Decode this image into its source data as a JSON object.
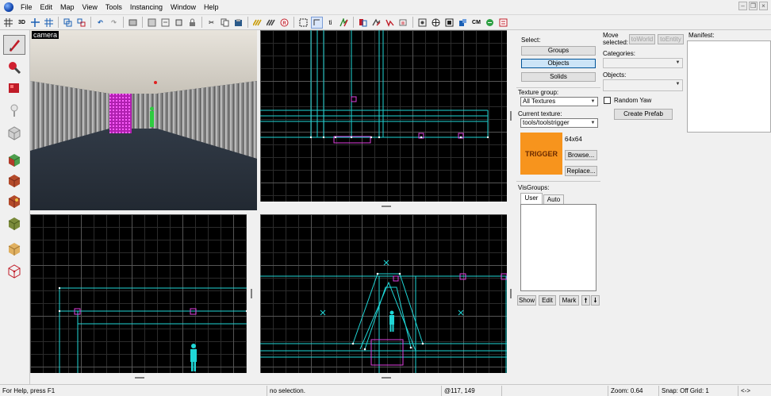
{
  "menu": {
    "items": [
      {
        "label": "File"
      },
      {
        "label": "Edit"
      },
      {
        "label": "Map"
      },
      {
        "label": "View"
      },
      {
        "label": "Tools"
      },
      {
        "label": "Instancing"
      },
      {
        "label": "Window"
      },
      {
        "label": "Help"
      }
    ]
  },
  "toolbar": {
    "cordon_label": "CM"
  },
  "viewports": {
    "camera_label": "camera"
  },
  "select_panel": {
    "label": "Select:",
    "groups_button": "Groups",
    "objects_button": "Objects",
    "solids_button": "Solids"
  },
  "texture_panel": {
    "group_label": "Texture group:",
    "group_value": "All Textures",
    "current_label": "Current texture:",
    "current_value": "tools/toolstrigger",
    "preview_text": "TRIGGER",
    "preview_color": "#f7941d",
    "size_text": "64x64",
    "browse_button": "Browse...",
    "replace_button": "Replace..."
  },
  "visgroups": {
    "label": "VisGroups:",
    "tabs": [
      "User",
      "Auto"
    ],
    "show_button": "Show",
    "edit_button": "Edit",
    "mark_button": "Mark",
    "up_icon": "up-arrow-icon",
    "down_icon": "down-arrow-icon"
  },
  "move_panel": {
    "label": "Move selected:",
    "to_world_button": "toWorld",
    "to_entity_button": "toEntity",
    "categories_label": "Categories:",
    "objects_label": "Objects:",
    "random_yaw_label": "Random Yaw",
    "create_prefab_button": "Create Prefab"
  },
  "manifest": {
    "label": "Manifest:"
  },
  "statusbar": {
    "help_text": "For Help, press F1",
    "selection_text": "no selection.",
    "coords_text": "@117, 149",
    "zoom_text": "Zoom: 0.64",
    "snap_text": "Snap: Off Grid: 1",
    "extra_text": "<->"
  },
  "colors": {
    "wire": "#1fd6d6",
    "entity": "#e040e0",
    "grid_bg": "#000000"
  }
}
